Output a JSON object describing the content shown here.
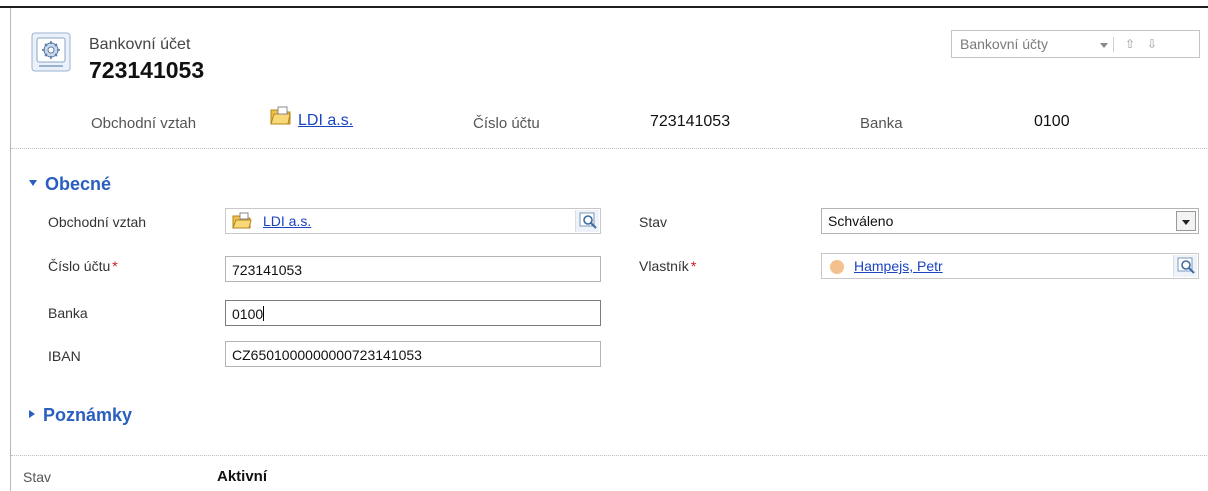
{
  "header": {
    "entity_type": "Bankovní účet",
    "entity_name": "723141053",
    "nav": {
      "label": "Bankovní účty"
    },
    "fields": {
      "relation_label": "Obchodní vztah",
      "relation_value": "LDI a.s.",
      "account_label": "Číslo účtu",
      "account_value": "723141053",
      "bank_label": "Banka",
      "bank_value": "0100"
    }
  },
  "sections": {
    "general": {
      "title": "Obecné",
      "relation_label": "Obchodní vztah",
      "relation_value": "LDI a.s.",
      "account_label": "Číslo účtu",
      "account_value": "723141053",
      "bank_label": "Banka",
      "bank_value": "0100",
      "iban_label": "IBAN",
      "iban_value": "CZ6501000000000723141053",
      "status_label": "Stav",
      "status_value": "Schváleno",
      "owner_label": "Vlastník",
      "owner_value": "Hampejs, Petr",
      "required_mark": "*"
    },
    "notes": {
      "title": "Poznámky"
    }
  },
  "footer": {
    "status_label": "Stav",
    "status_value": "Aktivní"
  },
  "colors": {
    "accent": "#2a5fbf",
    "link": "#1a44c2",
    "required": "#d21414"
  }
}
